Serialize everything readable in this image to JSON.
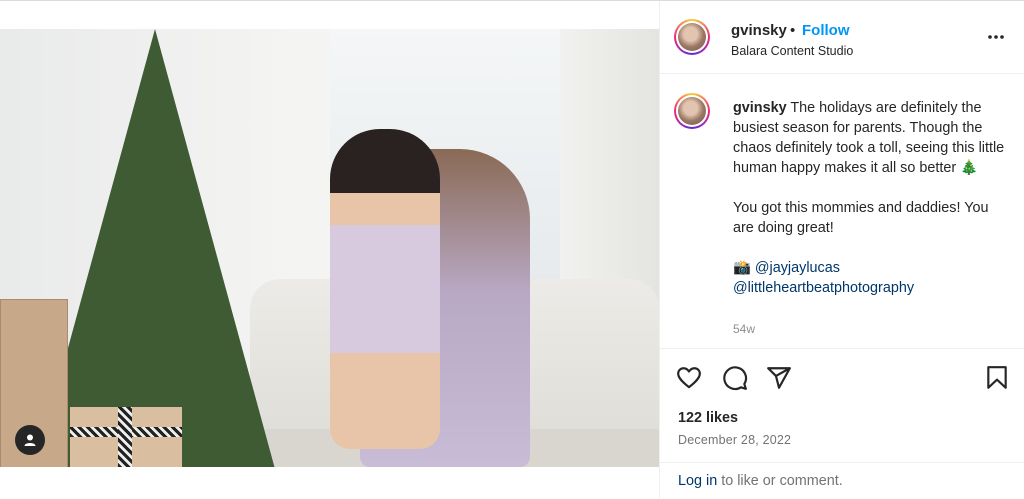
{
  "post": {
    "username": "gvinsky",
    "separator": "•",
    "follow_label": "Follow",
    "location": "Balara Content Studio",
    "more_icon": "more-horizontal-icon",
    "caption": {
      "username": "gvinsky",
      "line1": "The holidays are definitely the busiest season for parents. Though the chaos definitely took a toll, seeing this little human happy makes it all so better 🎄",
      "line2": "You got this mommies and daddies! You are doing great!",
      "camera_emoji": "📸",
      "mention1": "@jayjaylucas",
      "mention2": "@littleheartbeatphotography"
    },
    "time_ago": "54w",
    "actions": {
      "like_icon": "heart-icon",
      "comment_icon": "comment-icon",
      "share_icon": "send-icon",
      "save_icon": "bookmark-icon"
    },
    "likes": "122 likes",
    "date": "December 28, 2022",
    "login_link": "Log in",
    "login_rest": " to like or comment.",
    "tagged_people_icon": "user-icon"
  },
  "colors": {
    "follow": "#0095f6",
    "link": "#00376b",
    "muted": "#737373",
    "text": "#262626"
  }
}
